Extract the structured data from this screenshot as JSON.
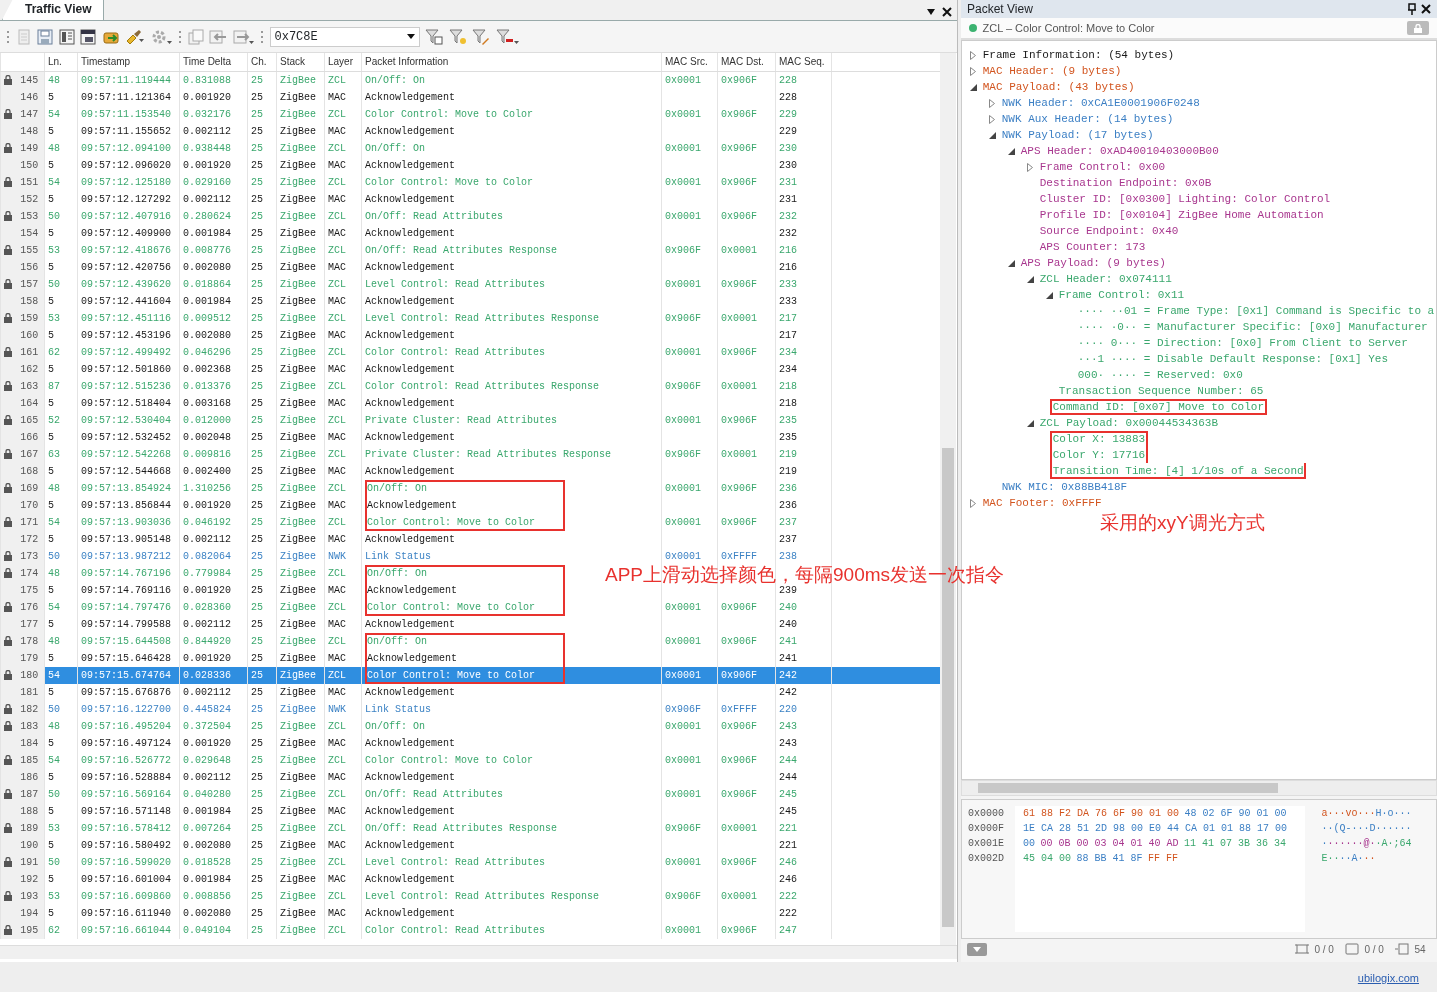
{
  "traffic_view": {
    "tab": "Traffic View",
    "filter_value": "0x7C8E",
    "columns": [
      "Ln.",
      "Timestamp",
      "Time Delta",
      "Ch.",
      "Stack",
      "Layer",
      "Packet Information",
      "MAC Src.",
      "MAC Dst.",
      "MAC Seq."
    ],
    "rows": [
      {
        "num": "145",
        "ln": "48",
        "time": "09:57:11.119444",
        "delta": "0.831088",
        "ch": "25",
        "stack": "ZigBee",
        "layer": "ZCL",
        "kind": "zcl",
        "info": "On/Off: On",
        "src": "0x0001",
        "dst": "0x906F",
        "seq": "228",
        "locked": true,
        "selected": false,
        "outlined": false
      },
      {
        "num": "146",
        "ln": "5",
        "time": "09:57:11.121364",
        "delta": "0.001920",
        "ch": "25",
        "stack": "ZigBee",
        "layer": "MAC",
        "kind": "mac",
        "info": "Acknowledgement",
        "seq": "228",
        "locked": false,
        "selected": false,
        "outlined": false
      },
      {
        "num": "147",
        "ln": "54",
        "time": "09:57:11.153540",
        "delta": "0.032176",
        "ch": "25",
        "stack": "ZigBee",
        "layer": "ZCL",
        "kind": "zcl",
        "info": "Color Control: Move to Color",
        "src": "0x0001",
        "dst": "0x906F",
        "seq": "229",
        "locked": true,
        "selected": false,
        "outlined": false
      },
      {
        "num": "148",
        "ln": "5",
        "time": "09:57:11.155652",
        "delta": "0.002112",
        "ch": "25",
        "stack": "ZigBee",
        "layer": "MAC",
        "kind": "mac",
        "info": "Acknowledgement",
        "seq": "229",
        "locked": false,
        "selected": false,
        "outlined": false
      },
      {
        "num": "149",
        "ln": "48",
        "time": "09:57:12.094100",
        "delta": "0.938448",
        "ch": "25",
        "stack": "ZigBee",
        "layer": "ZCL",
        "kind": "zcl",
        "info": "On/Off: On",
        "src": "0x0001",
        "dst": "0x906F",
        "seq": "230",
        "locked": true,
        "selected": false,
        "outlined": false
      },
      {
        "num": "150",
        "ln": "5",
        "time": "09:57:12.096020",
        "delta": "0.001920",
        "ch": "25",
        "stack": "ZigBee",
        "layer": "MAC",
        "kind": "mac",
        "info": "Acknowledgement",
        "seq": "230",
        "locked": false,
        "selected": false,
        "outlined": false
      },
      {
        "num": "151",
        "ln": "54",
        "time": "09:57:12.125180",
        "delta": "0.029160",
        "ch": "25",
        "stack": "ZigBee",
        "layer": "ZCL",
        "kind": "zcl",
        "info": "Color Control: Move to Color",
        "src": "0x0001",
        "dst": "0x906F",
        "seq": "231",
        "locked": true,
        "selected": false,
        "outlined": false
      },
      {
        "num": "152",
        "ln": "5",
        "time": "09:57:12.127292",
        "delta": "0.002112",
        "ch": "25",
        "stack": "ZigBee",
        "layer": "MAC",
        "kind": "mac",
        "info": "Acknowledgement",
        "seq": "231",
        "locked": false,
        "selected": false,
        "outlined": false
      },
      {
        "num": "153",
        "ln": "50",
        "time": "09:57:12.407916",
        "delta": "0.280624",
        "ch": "25",
        "stack": "ZigBee",
        "layer": "ZCL",
        "kind": "zcl",
        "info": "On/Off: Read Attributes",
        "src": "0x0001",
        "dst": "0x906F",
        "seq": "232",
        "locked": true,
        "selected": false,
        "outlined": false
      },
      {
        "num": "154",
        "ln": "5",
        "time": "09:57:12.409900",
        "delta": "0.001984",
        "ch": "25",
        "stack": "ZigBee",
        "layer": "MAC",
        "kind": "mac",
        "info": "Acknowledgement",
        "seq": "232",
        "locked": false,
        "selected": false,
        "outlined": false
      },
      {
        "num": "155",
        "ln": "53",
        "time": "09:57:12.418676",
        "delta": "0.008776",
        "ch": "25",
        "stack": "ZigBee",
        "layer": "ZCL",
        "kind": "zcl",
        "info": "On/Off: Read Attributes Response",
        "src": "0x906F",
        "dst": "0x0001",
        "seq": "216",
        "locked": true,
        "selected": false,
        "outlined": false
      },
      {
        "num": "156",
        "ln": "5",
        "time": "09:57:12.420756",
        "delta": "0.002080",
        "ch": "25",
        "stack": "ZigBee",
        "layer": "MAC",
        "kind": "mac",
        "info": "Acknowledgement",
        "seq": "216",
        "locked": false,
        "selected": false,
        "outlined": false
      },
      {
        "num": "157",
        "ln": "50",
        "time": "09:57:12.439620",
        "delta": "0.018864",
        "ch": "25",
        "stack": "ZigBee",
        "layer": "ZCL",
        "kind": "zcl",
        "info": "Level Control: Read Attributes",
        "src": "0x0001",
        "dst": "0x906F",
        "seq": "233",
        "locked": true,
        "selected": false,
        "outlined": false
      },
      {
        "num": "158",
        "ln": "5",
        "time": "09:57:12.441604",
        "delta": "0.001984",
        "ch": "25",
        "stack": "ZigBee",
        "layer": "MAC",
        "kind": "mac",
        "info": "Acknowledgement",
        "seq": "233",
        "locked": false,
        "selected": false,
        "outlined": false
      },
      {
        "num": "159",
        "ln": "53",
        "time": "09:57:12.451116",
        "delta": "0.009512",
        "ch": "25",
        "stack": "ZigBee",
        "layer": "ZCL",
        "kind": "zcl",
        "info": "Level Control: Read Attributes Response",
        "src": "0x906F",
        "dst": "0x0001",
        "seq": "217",
        "locked": true,
        "selected": false,
        "outlined": false
      },
      {
        "num": "160",
        "ln": "5",
        "time": "09:57:12.453196",
        "delta": "0.002080",
        "ch": "25",
        "stack": "ZigBee",
        "layer": "MAC",
        "kind": "mac",
        "info": "Acknowledgement",
        "seq": "217",
        "locked": false,
        "selected": false,
        "outlined": false
      },
      {
        "num": "161",
        "ln": "62",
        "time": "09:57:12.499492",
        "delta": "0.046296",
        "ch": "25",
        "stack": "ZigBee",
        "layer": "ZCL",
        "kind": "zcl",
        "info": "Color Control: Read Attributes",
        "src": "0x0001",
        "dst": "0x906F",
        "seq": "234",
        "locked": true,
        "selected": false,
        "outlined": false
      },
      {
        "num": "162",
        "ln": "5",
        "time": "09:57:12.501860",
        "delta": "0.002368",
        "ch": "25",
        "stack": "ZigBee",
        "layer": "MAC",
        "kind": "mac",
        "info": "Acknowledgement",
        "seq": "234",
        "locked": false,
        "selected": false,
        "outlined": false
      },
      {
        "num": "163",
        "ln": "87",
        "time": "09:57:12.515236",
        "delta": "0.013376",
        "ch": "25",
        "stack": "ZigBee",
        "layer": "ZCL",
        "kind": "zcl",
        "info": "Color Control: Read Attributes Response",
        "src": "0x906F",
        "dst": "0x0001",
        "seq": "218",
        "locked": true,
        "selected": false,
        "outlined": false
      },
      {
        "num": "164",
        "ln": "5",
        "time": "09:57:12.518404",
        "delta": "0.003168",
        "ch": "25",
        "stack": "ZigBee",
        "layer": "MAC",
        "kind": "mac",
        "info": "Acknowledgement",
        "seq": "218",
        "locked": false,
        "selected": false,
        "outlined": false
      },
      {
        "num": "165",
        "ln": "52",
        "time": "09:57:12.530404",
        "delta": "0.012000",
        "ch": "25",
        "stack": "ZigBee",
        "layer": "ZCL",
        "kind": "zcl",
        "info": "Private Cluster: Read Attributes",
        "src": "0x0001",
        "dst": "0x906F",
        "seq": "235",
        "locked": true,
        "selected": false,
        "outlined": false
      },
      {
        "num": "166",
        "ln": "5",
        "time": "09:57:12.532452",
        "delta": "0.002048",
        "ch": "25",
        "stack": "ZigBee",
        "layer": "MAC",
        "kind": "mac",
        "info": "Acknowledgement",
        "seq": "235",
        "locked": false,
        "selected": false,
        "outlined": false
      },
      {
        "num": "167",
        "ln": "63",
        "time": "09:57:12.542268",
        "delta": "0.009816",
        "ch": "25",
        "stack": "ZigBee",
        "layer": "ZCL",
        "kind": "zcl",
        "info": "Private Cluster: Read Attributes Response",
        "src": "0x906F",
        "dst": "0x0001",
        "seq": "219",
        "locked": true,
        "selected": false,
        "outlined": false
      },
      {
        "num": "168",
        "ln": "5",
        "time": "09:57:12.544668",
        "delta": "0.002400",
        "ch": "25",
        "stack": "ZigBee",
        "layer": "MAC",
        "kind": "mac",
        "info": "Acknowledgement",
        "seq": "219",
        "locked": false,
        "selected": false,
        "outlined": false
      },
      {
        "num": "169",
        "ln": "48",
        "time": "09:57:13.854924",
        "delta": "1.310256",
        "ch": "25",
        "stack": "ZigBee",
        "layer": "ZCL",
        "kind": "zcl",
        "info": "On/Off: On",
        "src": "0x0001",
        "dst": "0x906F",
        "seq": "236",
        "locked": true,
        "selected": false,
        "outlined": true
      },
      {
        "num": "170",
        "ln": "5",
        "time": "09:57:13.856844",
        "delta": "0.001920",
        "ch": "25",
        "stack": "ZigBee",
        "layer": "MAC",
        "kind": "mac",
        "info": "Acknowledgement",
        "seq": "236",
        "locked": false,
        "selected": false,
        "outlined": true
      },
      {
        "num": "171",
        "ln": "54",
        "time": "09:57:13.903036",
        "delta": "0.046192",
        "ch": "25",
        "stack": "ZigBee",
        "layer": "ZCL",
        "kind": "zcl",
        "info": "Color Control: Move to Color",
        "src": "0x0001",
        "dst": "0x906F",
        "seq": "237",
        "locked": true,
        "selected": false,
        "outlined": true
      },
      {
        "num": "172",
        "ln": "5",
        "time": "09:57:13.905148",
        "delta": "0.002112",
        "ch": "25",
        "stack": "ZigBee",
        "layer": "MAC",
        "kind": "mac",
        "info": "Acknowledgement",
        "seq": "237",
        "locked": false,
        "selected": false,
        "outlined": false
      },
      {
        "num": "173",
        "ln": "50",
        "time": "09:57:13.987212",
        "delta": "0.082064",
        "ch": "25",
        "stack": "ZigBee",
        "layer": "NWK",
        "kind": "nwk",
        "info": "Link Status",
        "src": "0x0001",
        "dst": "0xFFFF",
        "seq": "238",
        "locked": true,
        "selected": false,
        "outlined": false
      },
      {
        "num": "174",
        "ln": "48",
        "time": "09:57:14.767196",
        "delta": "0.779984",
        "ch": "25",
        "stack": "ZigBee",
        "layer": "ZCL",
        "kind": "zcl",
        "info": "On/Off: On",
        "locked": true,
        "selected": false,
        "outlined": true
      },
      {
        "num": "175",
        "ln": "5",
        "time": "09:57:14.769116",
        "delta": "0.001920",
        "ch": "25",
        "stack": "ZigBee",
        "layer": "MAC",
        "kind": "mac",
        "info": "Acknowledgement",
        "seq": "239",
        "locked": false,
        "selected": false,
        "outlined": true
      },
      {
        "num": "176",
        "ln": "54",
        "time": "09:57:14.797476",
        "delta": "0.028360",
        "ch": "25",
        "stack": "ZigBee",
        "layer": "ZCL",
        "kind": "zcl",
        "info": "Color Control: Move to Color",
        "src": "0x0001",
        "dst": "0x906F",
        "seq": "240",
        "locked": true,
        "selected": false,
        "outlined": true
      },
      {
        "num": "177",
        "ln": "5",
        "time": "09:57:14.799588",
        "delta": "0.002112",
        "ch": "25",
        "stack": "ZigBee",
        "layer": "MAC",
        "kind": "mac",
        "info": "Acknowledgement",
        "seq": "240",
        "locked": false,
        "selected": false,
        "outlined": false
      },
      {
        "num": "178",
        "ln": "48",
        "time": "09:57:15.644508",
        "delta": "0.844920",
        "ch": "25",
        "stack": "ZigBee",
        "layer": "ZCL",
        "kind": "zcl",
        "info": "On/Off: On",
        "src": "0x0001",
        "dst": "0x906F",
        "seq": "241",
        "locked": true,
        "selected": false,
        "outlined": true
      },
      {
        "num": "179",
        "ln": "5",
        "time": "09:57:15.646428",
        "delta": "0.001920",
        "ch": "25",
        "stack": "ZigBee",
        "layer": "MAC",
        "kind": "mac",
        "info": "Acknowledgement",
        "seq": "241",
        "locked": false,
        "selected": false,
        "outlined": true
      },
      {
        "num": "180",
        "ln": "54",
        "time": "09:57:15.674764",
        "delta": "0.028336",
        "ch": "25",
        "stack": "ZigBee",
        "layer": "ZCL",
        "kind": "zcl",
        "info": "Color Control: Move to Color",
        "src": "0x0001",
        "dst": "0x906F",
        "seq": "242",
        "locked": true,
        "selected": true,
        "outlined": true
      },
      {
        "num": "181",
        "ln": "5",
        "time": "09:57:15.676876",
        "delta": "0.002112",
        "ch": "25",
        "stack": "ZigBee",
        "layer": "MAC",
        "kind": "mac",
        "info": "Acknowledgement",
        "seq": "242",
        "locked": false,
        "selected": false,
        "outlined": false
      },
      {
        "num": "182",
        "ln": "50",
        "time": "09:57:16.122700",
        "delta": "0.445824",
        "ch": "25",
        "stack": "ZigBee",
        "layer": "NWK",
        "kind": "nwk",
        "info": "Link Status",
        "src": "0x906F",
        "dst": "0xFFFF",
        "seq": "220",
        "locked": true,
        "selected": false,
        "outlined": false
      },
      {
        "num": "183",
        "ln": "48",
        "time": "09:57:16.495204",
        "delta": "0.372504",
        "ch": "25",
        "stack": "ZigBee",
        "layer": "ZCL",
        "kind": "zcl",
        "info": "On/Off: On",
        "src": "0x0001",
        "dst": "0x906F",
        "seq": "243",
        "locked": true,
        "selected": false,
        "outlined": false
      },
      {
        "num": "184",
        "ln": "5",
        "time": "09:57:16.497124",
        "delta": "0.001920",
        "ch": "25",
        "stack": "ZigBee",
        "layer": "MAC",
        "kind": "mac",
        "info": "Acknowledgement",
        "seq": "243",
        "locked": false,
        "selected": false,
        "outlined": false
      },
      {
        "num": "185",
        "ln": "54",
        "time": "09:57:16.526772",
        "delta": "0.029648",
        "ch": "25",
        "stack": "ZigBee",
        "layer": "ZCL",
        "kind": "zcl",
        "info": "Color Control: Move to Color",
        "src": "0x0001",
        "dst": "0x906F",
        "seq": "244",
        "locked": true,
        "selected": false,
        "outlined": false
      },
      {
        "num": "186",
        "ln": "5",
        "time": "09:57:16.528884",
        "delta": "0.002112",
        "ch": "25",
        "stack": "ZigBee",
        "layer": "MAC",
        "kind": "mac",
        "info": "Acknowledgement",
        "seq": "244",
        "locked": false,
        "selected": false,
        "outlined": false
      },
      {
        "num": "187",
        "ln": "50",
        "time": "09:57:16.569164",
        "delta": "0.040280",
        "ch": "25",
        "stack": "ZigBee",
        "layer": "ZCL",
        "kind": "zcl",
        "info": "On/Off: Read Attributes",
        "src": "0x0001",
        "dst": "0x906F",
        "seq": "245",
        "locked": true,
        "selected": false,
        "outlined": false
      },
      {
        "num": "188",
        "ln": "5",
        "time": "09:57:16.571148",
        "delta": "0.001984",
        "ch": "25",
        "stack": "ZigBee",
        "layer": "MAC",
        "kind": "mac",
        "info": "Acknowledgement",
        "seq": "245",
        "locked": false,
        "selected": false,
        "outlined": false
      },
      {
        "num": "189",
        "ln": "53",
        "time": "09:57:16.578412",
        "delta": "0.007264",
        "ch": "25",
        "stack": "ZigBee",
        "layer": "ZCL",
        "kind": "zcl",
        "info": "On/Off: Read Attributes Response",
        "src": "0x906F",
        "dst": "0x0001",
        "seq": "221",
        "locked": true,
        "selected": false,
        "outlined": false
      },
      {
        "num": "190",
        "ln": "5",
        "time": "09:57:16.580492",
        "delta": "0.002080",
        "ch": "25",
        "stack": "ZigBee",
        "layer": "MAC",
        "kind": "mac",
        "info": "Acknowledgement",
        "seq": "221",
        "locked": false,
        "selected": false,
        "outlined": false
      },
      {
        "num": "191",
        "ln": "50",
        "time": "09:57:16.599020",
        "delta": "0.018528",
        "ch": "25",
        "stack": "ZigBee",
        "layer": "ZCL",
        "kind": "zcl",
        "info": "Level Control: Read Attributes",
        "src": "0x0001",
        "dst": "0x906F",
        "seq": "246",
        "locked": true,
        "selected": false,
        "outlined": false
      },
      {
        "num": "192",
        "ln": "5",
        "time": "09:57:16.601004",
        "delta": "0.001984",
        "ch": "25",
        "stack": "ZigBee",
        "layer": "MAC",
        "kind": "mac",
        "info": "Acknowledgement",
        "seq": "246",
        "locked": false,
        "selected": false,
        "outlined": false
      },
      {
        "num": "193",
        "ln": "53",
        "time": "09:57:16.609860",
        "delta": "0.008856",
        "ch": "25",
        "stack": "ZigBee",
        "layer": "ZCL",
        "kind": "zcl",
        "info": "Level Control: Read Attributes Response",
        "src": "0x906F",
        "dst": "0x0001",
        "seq": "222",
        "locked": true,
        "selected": false,
        "outlined": false
      },
      {
        "num": "194",
        "ln": "5",
        "time": "09:57:16.611940",
        "delta": "0.002080",
        "ch": "25",
        "stack": "ZigBee",
        "layer": "MAC",
        "kind": "mac",
        "info": "Acknowledgement",
        "seq": "222",
        "locked": false,
        "selected": false,
        "outlined": false
      },
      {
        "num": "195",
        "ln": "62",
        "time": "09:57:16.661044",
        "delta": "0.049104",
        "ch": "25",
        "stack": "ZigBee",
        "layer": "ZCL",
        "kind": "zcl",
        "info": "Color Control: Read Attributes",
        "src": "0x0001",
        "dst": "0x906F",
        "seq": "247",
        "locked": true,
        "selected": false,
        "outlined": false
      }
    ]
  },
  "packet_view": {
    "title": "Packet View",
    "summary": "ZCL – Color Control: Move to Color",
    "tree": [
      {
        "text": "Frame Information: (54 bytes)",
        "kind": "frame",
        "expanded": false,
        "outlined": false
      },
      {
        "text": "MAC Header: (9 bytes)",
        "kind": "mac",
        "expanded": false,
        "outlined": false
      },
      {
        "text": "MAC Payload: (43 bytes)",
        "kind": "mac",
        "expanded": true,
        "outlined": false,
        "children": [
          {
            "text": "NWK Header: 0xCA1E0001906F0248",
            "kind": "nwk",
            "expanded": false,
            "outlined": false
          },
          {
            "text": "NWK Aux Header: (14 bytes)",
            "kind": "nwk",
            "expanded": false,
            "outlined": false
          },
          {
            "text": "NWK Payload: (17 bytes)",
            "kind": "nwk",
            "expanded": true,
            "outlined": false,
            "children": [
              {
                "text": "APS Header: 0xAD40010403000B00",
                "kind": "aps",
                "expanded": true,
                "outlined": false,
                "children": [
                  {
                    "text": "Frame Control: 0x00",
                    "kind": "aps",
                    "expanded": false,
                    "outlined": false
                  },
                  {
                    "text": "Destination Endpoint: 0x0B",
                    "kind": "aps",
                    "outlined": false
                  },
                  {
                    "text": "Cluster ID: [0x0300] Lighting: Color Control",
                    "kind": "aps",
                    "outlined": false
                  },
                  {
                    "text": "Profile ID: [0x0104] ZigBee Home Automation",
                    "kind": "aps",
                    "outlined": false
                  },
                  {
                    "text": "Source Endpoint: 0x40",
                    "kind": "aps",
                    "outlined": false
                  },
                  {
                    "text": "APS Counter: 173",
                    "kind": "aps",
                    "outlined": false
                  }
                ]
              },
              {
                "text": "APS Payload: (9 bytes)",
                "kind": "aps",
                "expanded": true,
                "outlined": false,
                "children": [
                  {
                    "text": "ZCL Header: 0x074111",
                    "kind": "zcl",
                    "expanded": true,
                    "outlined": false,
                    "children": [
                      {
                        "text": "Frame Control: 0x11",
                        "kind": "zcl",
                        "expanded": true,
                        "outlined": false,
                        "children": [
                          {
                            "text": "···· ··01 = Frame Type: [0x1] Command is Specific to a",
                            "kind": "zcl",
                            "outlined": false
                          },
                          {
                            "text": "···· ·0·· = Manufacturer Specific: [0x0] Manufacturer",
                            "kind": "zcl",
                            "outlined": false
                          },
                          {
                            "text": "···· 0··· = Direction: [0x0] From Client to Server",
                            "kind": "zcl",
                            "outlined": false
                          },
                          {
                            "text": "···1 ···· = Disable Default Response: [0x1] Yes",
                            "kind": "zcl",
                            "outlined": false
                          },
                          {
                            "text": "000· ···· = Reserved: 0x0",
                            "kind": "zcl",
                            "outlined": false
                          }
                        ]
                      },
                      {
                        "text": "Transaction Sequence Number: 65",
                        "kind": "zcl",
                        "outlined": false
                      },
                      {
                        "text": "Command ID: [0x07] Move to Color",
                        "kind": "zcl",
                        "outlined": true
                      }
                    ]
                  },
                  {
                    "text": "ZCL Payload: 0x00044534363B",
                    "kind": "zcl",
                    "expanded": true,
                    "outlined": false,
                    "children": [
                      {
                        "text": "Color X: 13883",
                        "kind": "zcl",
                        "outlined": true
                      },
                      {
                        "text": "Color Y: 17716",
                        "kind": "zcl",
                        "outlined": true
                      },
                      {
                        "text": "Transition Time: [4] 1/10s of a Second",
                        "kind": "zcl",
                        "outlined": true
                      }
                    ]
                  }
                ]
              }
            ]
          },
          {
            "text": "NWK MIC: 0x88BB418F",
            "kind": "nwk",
            "outlined": false
          }
        ]
      },
      {
        "text": "MAC Footer: 0xFFFF",
        "kind": "mac",
        "expanded": false,
        "outlined": false
      }
    ],
    "hex": [
      {
        "offset": "0x0000",
        "segments": [
          {
            "kind": "mac",
            "hex": "61 88 F2 DA 76 6F 90 01 00",
            "ascii": "a···vo···"
          },
          {
            "kind": "nwk",
            "hex": "48 02 6F 90 01 00",
            "ascii": "H·o···"
          }
        ]
      },
      {
        "offset": "0x000F",
        "segments": [
          {
            "kind": "nwk",
            "hex": "1E CA 28 51 2D 98 00 E0 44 CA 01 01 88 17 00",
            "ascii": "··(Q-···D······"
          }
        ]
      },
      {
        "offset": "0x001E",
        "segments": [
          {
            "kind": "nwk",
            "hex": "00",
            "ascii": "·"
          },
          {
            "kind": "aps",
            "hex": "00 0B 00 03 04 01 40 AD",
            "ascii": "······@·"
          },
          {
            "kind": "zcl",
            "hex": "11 41 07 3B 36 34",
            "ascii": "·A·;64"
          }
        ]
      },
      {
        "offset": "0x002D",
        "segments": [
          {
            "kind": "zcl",
            "hex": "45 04 00",
            "ascii": "E··"
          },
          {
            "kind": "nwk",
            "hex": "88 BB 41 8F",
            "ascii": "··A·"
          },
          {
            "kind": "mac",
            "hex": "FF FF",
            "ascii": "··"
          }
        ]
      }
    ],
    "counters": [
      "0 / 0",
      "0 / 0",
      "54"
    ],
    "link": "ubilogix.com"
  },
  "notes": [
    "APP上滑动选择颜色，每隔900ms发送一次指令",
    "采用的xyY调光方式"
  ]
}
